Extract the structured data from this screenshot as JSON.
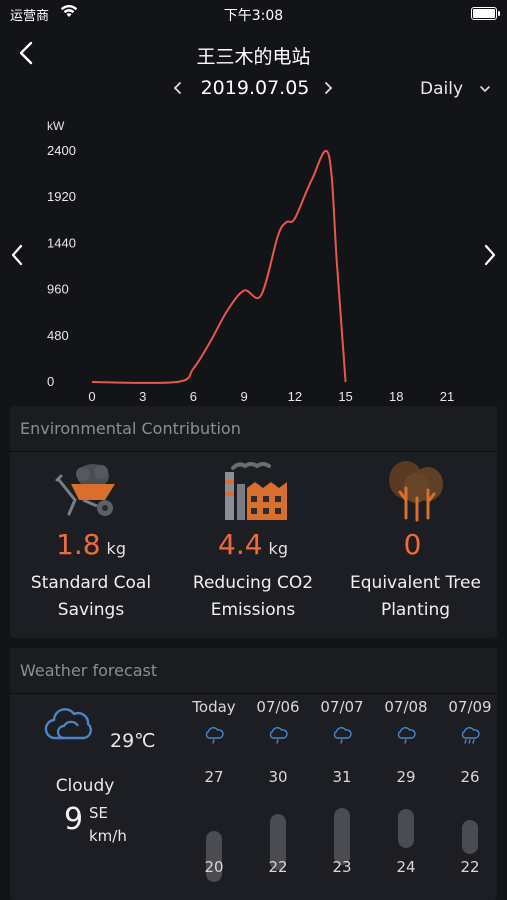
{
  "status": {
    "carrier": "运营商",
    "time": "下午3:08"
  },
  "nav": {
    "title": "王三木的电站"
  },
  "date_selector": {
    "date": "2019.07.05",
    "period": "Daily"
  },
  "chart_data": {
    "type": "line",
    "ylabel": "kW",
    "ylim": [
      0,
      2400
    ],
    "yticks": [
      0,
      480,
      960,
      1440,
      1920,
      2400
    ],
    "xlim": [
      0,
      23
    ],
    "xticks": [
      0,
      3,
      6,
      9,
      12,
      15,
      18,
      21
    ],
    "color": "#e8564f",
    "series": [
      {
        "x": [
          0,
          5,
          6,
          7,
          8,
          9,
          10,
          11,
          11.5,
          12,
          13,
          14,
          14.5,
          15
        ],
        "y": [
          0,
          0,
          140,
          420,
          740,
          950,
          900,
          1520,
          1660,
          1700,
          2100,
          2360,
          1200,
          0
        ]
      }
    ]
  },
  "env": {
    "title": "Environmental Contribution",
    "items": [
      {
        "value": "1.8",
        "unit": "kg",
        "label1": "Standard Coal",
        "label2": "Savings"
      },
      {
        "value": "4.4",
        "unit": "kg",
        "label1": "Reducing CO2",
        "label2": "Emissions"
      },
      {
        "value": "0",
        "unit": "",
        "label1": "Equivalent Tree",
        "label2": "Planting"
      }
    ]
  },
  "weather": {
    "title": "Weather forecast",
    "current": {
      "temp": "29℃",
      "condition": "Cloudy",
      "wind_speed": "9",
      "wind_dir": "SE",
      "wind_unit": "km/h"
    },
    "forecast": [
      {
        "date": "Today",
        "high": "27",
        "low": "20",
        "icon": "rain-icon"
      },
      {
        "date": "07/06",
        "high": "30",
        "low": "22",
        "icon": "rain-icon"
      },
      {
        "date": "07/07",
        "high": "31",
        "low": "23",
        "icon": "rain-icon"
      },
      {
        "date": "07/08",
        "high": "29",
        "low": "24",
        "icon": "rain-icon"
      },
      {
        "date": "07/09",
        "high": "26",
        "low": "22",
        "icon": "heavy-rain-icon"
      }
    ]
  }
}
